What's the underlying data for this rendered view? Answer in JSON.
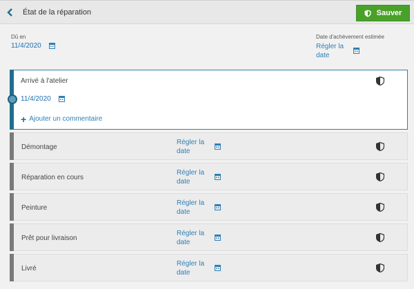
{
  "header": {
    "title": "État de la réparation",
    "save_label": "Sauver"
  },
  "due": {
    "label": "Dû en",
    "value": "11/4/2020"
  },
  "estimated": {
    "label": "Date d'achèvement estimée",
    "link_line1": "Régler la",
    "link_line2": "date"
  },
  "active_step": {
    "label": "Arrivé à l'atelier",
    "date": "11/4/2020",
    "add_comment": "Ajouter un commentaire"
  },
  "steps": [
    {
      "label": "Démontage",
      "link_line1": "Régler la",
      "link_line2": "date"
    },
    {
      "label": "Réparation en cours",
      "link_line1": "Régler la",
      "link_line2": "date"
    },
    {
      "label": "Peinture",
      "link_line1": "Régler la",
      "link_line2": "date"
    },
    {
      "label": "Prêt pour livraison",
      "link_line1": "Régler la",
      "link_line2": "date"
    },
    {
      "label": "Livré",
      "link_line1": "Régler la",
      "link_line2": "date"
    }
  ],
  "colors": {
    "accent": "#1f6f8f",
    "save": "#4aa12a",
    "link": "#2f7fb5"
  },
  "icons": {
    "back": "chevron-left-icon",
    "save": "shield-icon",
    "calendar": "calendar-icon",
    "status": "half-shield-icon",
    "add": "plus-icon"
  }
}
